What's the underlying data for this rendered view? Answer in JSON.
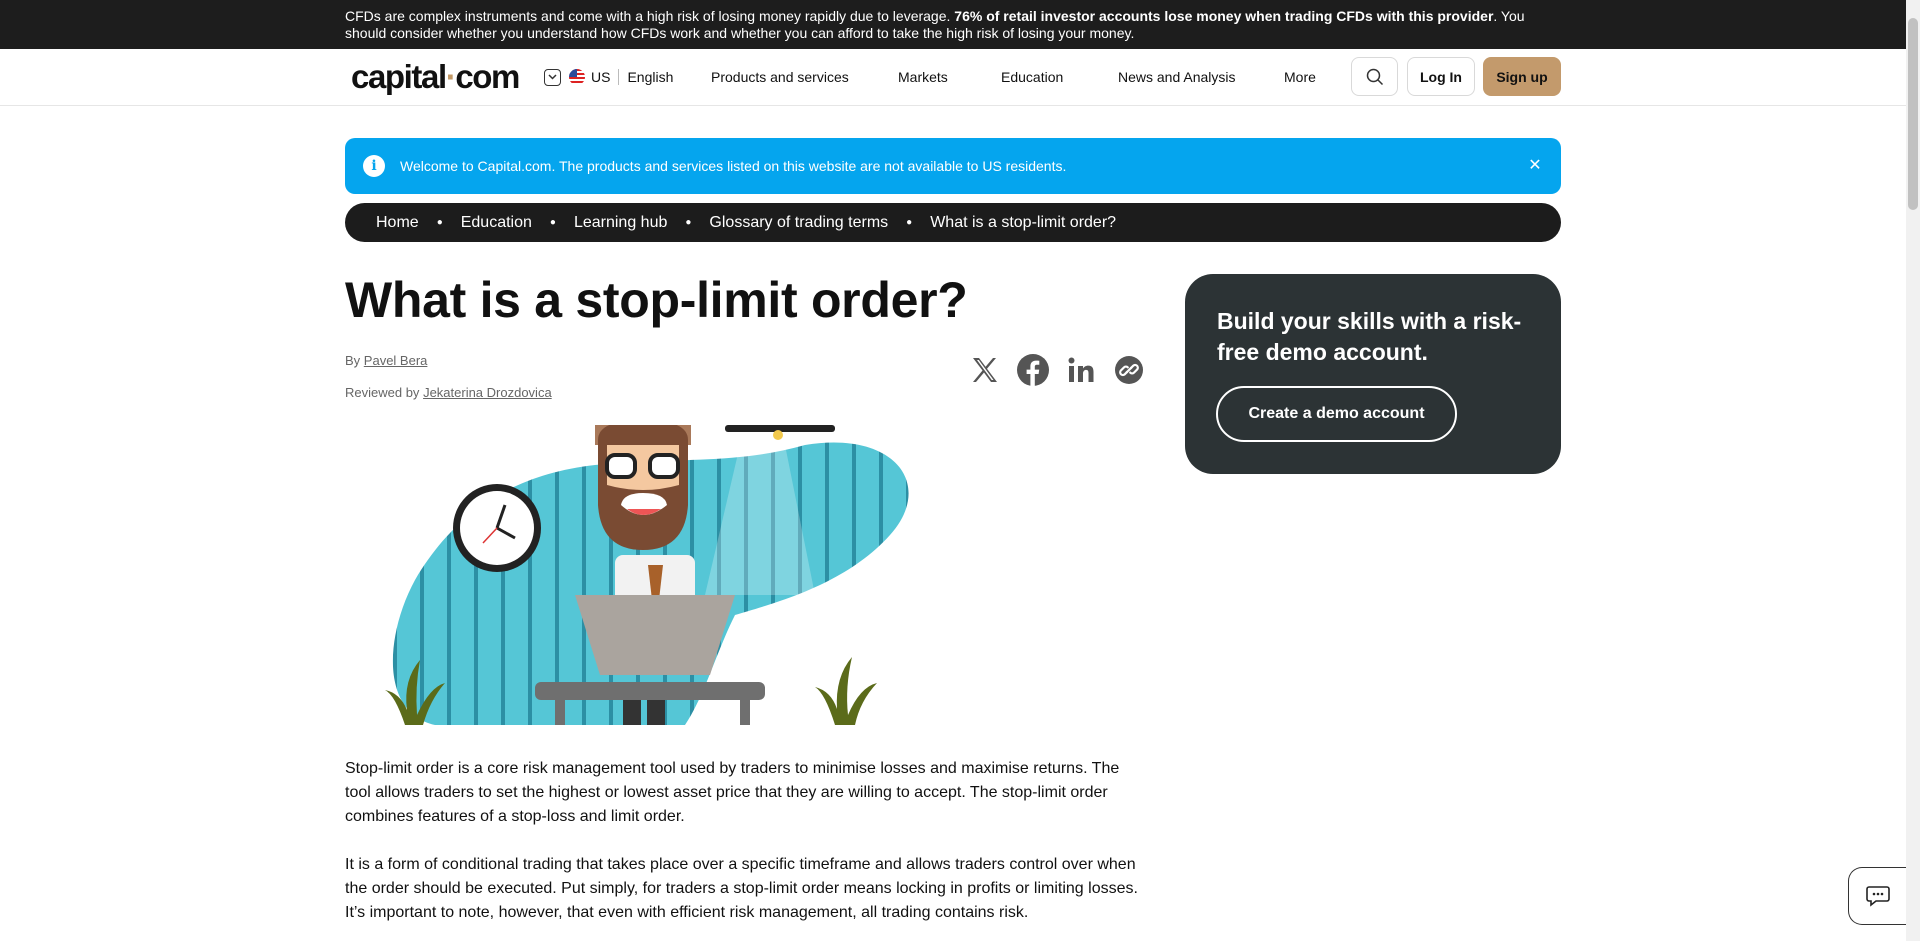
{
  "risk_banner": {
    "text_start": "CFDs are complex instruments and come with a high risk of losing money rapidly due to leverage.",
    "text_bold": "76% of retail investor accounts lose money when trading CFDs with this provider",
    "text_end": ". You should consider whether you understand how CFDs work and whether you can afford to take the high risk of losing your money."
  },
  "header": {
    "logo_left": "capital",
    "logo_dot": "·",
    "logo_right": "com",
    "region": "US",
    "language": "English",
    "nav": [
      "Products and services",
      "Markets",
      "Education",
      "News and Analysis",
      "More"
    ],
    "login_label": "Log In",
    "signup_label": "Sign up"
  },
  "notice": {
    "text": "Welcome to Capital.com. The products and services listed on this website are not available to US residents.",
    "close": "✕"
  },
  "breadcrumb": [
    "Home",
    "Education",
    "Learning hub",
    "Glossary of trading terms",
    "What is a stop-limit order?"
  ],
  "article": {
    "title": "What is a stop-limit order?",
    "by_prefix": "By",
    "author": "Pavel Bera",
    "reviewed_prefix": "Reviewed by",
    "reviewer": "Jekaterina Drozdovica",
    "paragraphs": [
      "Stop-limit order is a core risk management tool used by traders to minimise losses and maximise returns. The tool allows traders to set the highest or lowest asset price that they are willing to accept. The stop-limit order combines features of a stop-loss and limit order.",
      "It is a form of conditional trading that takes place over a specific timeframe and allows traders control over when the order should be executed. Put simply, for traders a stop-limit order means locking in profits or limiting losses. It’s important to note, however, that even with efficient risk management, all trading contains risk."
    ]
  },
  "share_icons": [
    "x-icon",
    "facebook-icon",
    "linkedin-icon",
    "copy-link-icon"
  ],
  "promo": {
    "title": "Build your skills with a risk-free demo account.",
    "button": "Create a demo account"
  },
  "colors": {
    "accent": "#c39a6c",
    "notice_bg": "#05a5ee",
    "dark": "#1c1c1c",
    "promo_bg": "#2c3335"
  }
}
